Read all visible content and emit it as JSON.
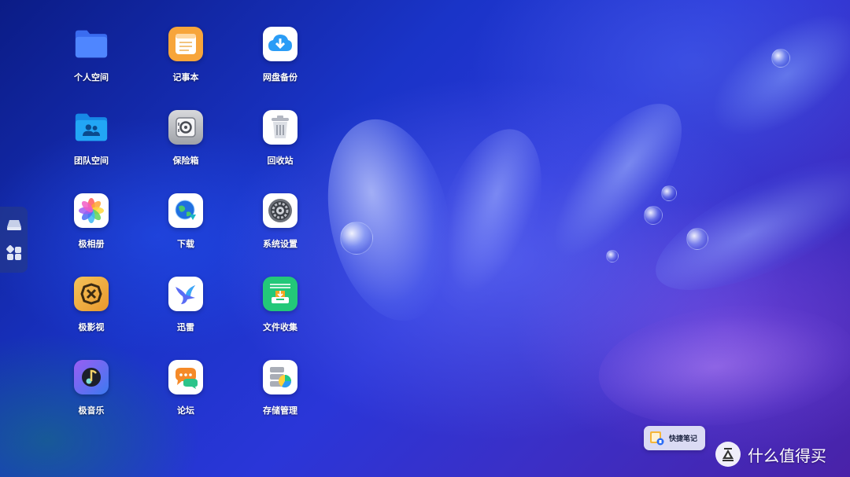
{
  "apps": [
    {
      "label": "个人空间",
      "icon": "folder-icon"
    },
    {
      "label": "记事本",
      "icon": "notepad-icon"
    },
    {
      "label": "网盘备份",
      "icon": "cloud-download-icon"
    },
    {
      "label": "团队空间",
      "icon": "team-folder-icon"
    },
    {
      "label": "保险箱",
      "icon": "safe-icon"
    },
    {
      "label": "回收站",
      "icon": "trash-icon"
    },
    {
      "label": "极相册",
      "icon": "photos-icon"
    },
    {
      "label": "下载",
      "icon": "globe-download-icon"
    },
    {
      "label": "系统设置",
      "icon": "settings-icon"
    },
    {
      "label": "极影视",
      "icon": "video-icon"
    },
    {
      "label": "迅雷",
      "icon": "thunder-bird-icon"
    },
    {
      "label": "文件收集",
      "icon": "file-collect-icon"
    },
    {
      "label": "极音乐",
      "icon": "music-icon"
    },
    {
      "label": "论坛",
      "icon": "forum-chat-icon"
    },
    {
      "label": "存储管理",
      "icon": "storage-icon"
    }
  ],
  "side_dock": {
    "items": [
      {
        "icon": "drive-icon"
      },
      {
        "icon": "widgets-icon"
      }
    ]
  },
  "quick_note": {
    "label": "快捷笔记",
    "icon": "quick-note-icon"
  },
  "watermark": {
    "text": "什么值得买",
    "icon": "smzdm-logo-icon"
  },
  "colors": {
    "accent_blue": "#2a6cf6",
    "notepad_orange": "#f7a53b",
    "file_collect_green": "#23c879"
  }
}
